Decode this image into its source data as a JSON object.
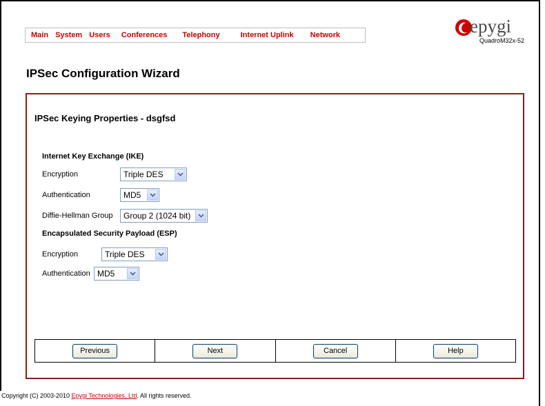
{
  "nav": {
    "items": [
      {
        "label": "Main"
      },
      {
        "label": "System"
      },
      {
        "label": "Users"
      },
      {
        "label": "Conferences"
      },
      {
        "label": "Telephony"
      },
      {
        "label": "Internet Uplink"
      },
      {
        "label": "Network"
      }
    ]
  },
  "logo": {
    "text": "epygi",
    "model": "QuadroM32x-52",
    "icon": "epygi-logo-icon",
    "color": "#cc0000"
  },
  "page": {
    "title": "IPSec Configuration Wizard"
  },
  "form": {
    "section_title": "IPSec Keying Properties - dsgfsd",
    "ike": {
      "title": "Internet Key Exchange (IKE)",
      "encryption_label": "Encryption",
      "encryption_value": "Triple DES",
      "authentication_label": "Authentication",
      "authentication_value": "MD5",
      "dh_label": "Diffie-Hellman Group",
      "dh_value": "Group 2 (1024 bit)"
    },
    "esp": {
      "title": "Encapsulated Security Payload (ESP)",
      "encryption_label": "Encryption",
      "encryption_value": "Triple DES",
      "authentication_label": "Authentication",
      "authentication_value": "MD5"
    }
  },
  "buttons": {
    "previous": "Previous",
    "next": "Next",
    "cancel": "Cancel",
    "help": "Help"
  },
  "footer": {
    "prefix": "Copyright (C) 2003-2010 ",
    "link": "Epygi Technologies, Ltd",
    "suffix": ". All rights reserved."
  },
  "colors": {
    "accent": "#cc0000",
    "box_border": "#8b1c1c"
  }
}
